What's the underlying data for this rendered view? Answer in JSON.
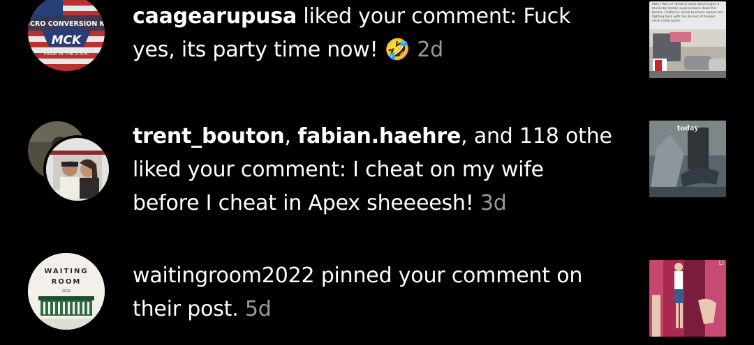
{
  "notifications": [
    {
      "actor": "caagearupusa",
      "line1_rest": " liked your comment: Fuck",
      "line2": "yes, its party time now! ",
      "emoji": "🤣",
      "timestamp": "2d",
      "avatar_text": {
        "top": "MICRO CONVERSION KIT",
        "logo": "MCK",
        "bottom": "MADE IN THE U.S.A."
      },
      "thumb_text": "MUST WATCH! Beverly store owners give a movie-be hidden surprise back down the Berlinr, California. Small business owners are fighting back with the Berrust of funded retail crime spree."
    },
    {
      "actor1": "trent_bouton",
      "sep": ", ",
      "actor2": "fabian.haehre",
      "line1_rest": ", and 118 othe",
      "line2": "liked your comment: I cheat on my wife",
      "line3": "before I cheat in Apex sheeeesh! ",
      "timestamp": "3d",
      "thumb_label": "today"
    },
    {
      "line1": "waitingroom2022 pinned your comment on",
      "line2": "their post. ",
      "timestamp": "5d",
      "avatar_text": {
        "top": "WAITING",
        "mid": "ROOM",
        "year": "2022"
      },
      "thumb_label": "Li"
    }
  ]
}
